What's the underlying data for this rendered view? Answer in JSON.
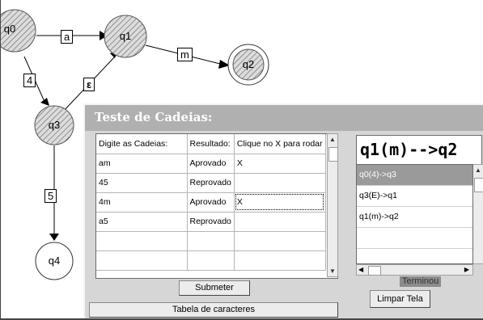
{
  "diagram": {
    "states": [
      "q0",
      "q1",
      "q2",
      "q3",
      "q4"
    ],
    "edges": [
      {
        "from": "q0",
        "to": "q1",
        "label": "a"
      },
      {
        "from": "q0",
        "to": "q3",
        "label": "4"
      },
      {
        "from": "q3",
        "to": "q1",
        "label": "ε"
      },
      {
        "from": "q1",
        "to": "q2",
        "label": "m"
      },
      {
        "from": "q3",
        "to": "q4",
        "label": "5"
      }
    ]
  },
  "dialog": {
    "title": "Teste de Cadeias:",
    "table": {
      "headers": [
        "Digite as Cadeias:",
        "Resultado:",
        "Clique no X para rodar"
      ],
      "rows": [
        [
          "am",
          "Aprovado",
          "X"
        ],
        [
          "45",
          "Reprovado",
          ""
        ],
        [
          "4m",
          "Aprovado",
          "X"
        ],
        [
          "a5",
          "Reprovado",
          ""
        ],
        [
          "",
          "",
          ""
        ],
        [
          "",
          "",
          ""
        ]
      ]
    },
    "submit_label": "Submeter",
    "char_table_label": "Tabela de caracteres",
    "result_title": "q1(m)-->q2",
    "result_steps": [
      "q0(4)->q3",
      "q3(E)->q1",
      "q1(m)->q2"
    ],
    "status": "Terminou",
    "clear_label": "Limpar Tela"
  }
}
